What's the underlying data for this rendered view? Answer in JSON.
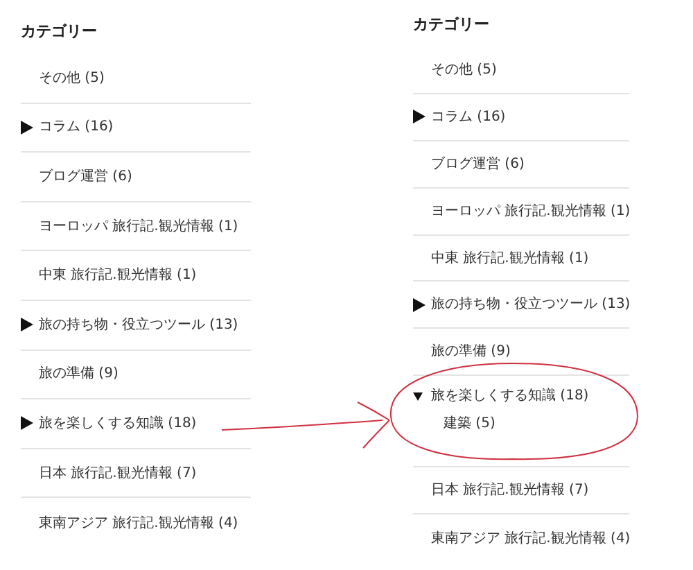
{
  "panels": [
    {
      "title": "カテゴリー",
      "items": [
        {
          "label": "その他 (5)",
          "kind": "leaf"
        },
        {
          "label": "コラム (16)",
          "kind": "parent",
          "expanded": false
        },
        {
          "label": "ブログ運営 (6)",
          "kind": "leaf"
        },
        {
          "label": "ヨーロッパ 旅行記.観光情報 (1)",
          "kind": "leaf"
        },
        {
          "label": "中東 旅行記.観光情報 (1)",
          "kind": "leaf"
        },
        {
          "label": "旅の持ち物・役立つツール (13)",
          "kind": "parent",
          "expanded": false
        },
        {
          "label": "旅の準備 (9)",
          "kind": "leaf"
        },
        {
          "label": "旅を楽しくする知識 (18)",
          "kind": "parent",
          "expanded": false
        },
        {
          "label": "日本 旅行記.観光情報 (7)",
          "kind": "leaf"
        },
        {
          "label": "東南アジア 旅行記.観光情報 (4)",
          "kind": "leaf"
        }
      ]
    },
    {
      "title": "カテゴリー",
      "items": [
        {
          "label": "その他 (5)",
          "kind": "leaf"
        },
        {
          "label": "コラム (16)",
          "kind": "parent",
          "expanded": false
        },
        {
          "label": "ブログ運営 (6)",
          "kind": "leaf"
        },
        {
          "label": "ヨーロッパ 旅行記.観光情報 (1)",
          "kind": "leaf"
        },
        {
          "label": "中東 旅行記.観光情報 (1)",
          "kind": "leaf"
        },
        {
          "label": "旅の持ち物・役立つツール (13)",
          "kind": "parent",
          "expanded": false
        },
        {
          "label": "旅の準備 (9)",
          "kind": "leaf"
        },
        {
          "label": "旅を楽しくする知識 (18)",
          "kind": "parent",
          "expanded": true,
          "children": [
            {
              "label": "建築 (5)",
              "kind": "leaf"
            }
          ]
        },
        {
          "label": "日本 旅行記.観光情報 (7)",
          "kind": "leaf"
        },
        {
          "label": "東南アジア 旅行記.観光情報 (4)",
          "kind": "leaf"
        }
      ]
    }
  ],
  "annotations": {
    "arrow": true,
    "circle": true
  }
}
